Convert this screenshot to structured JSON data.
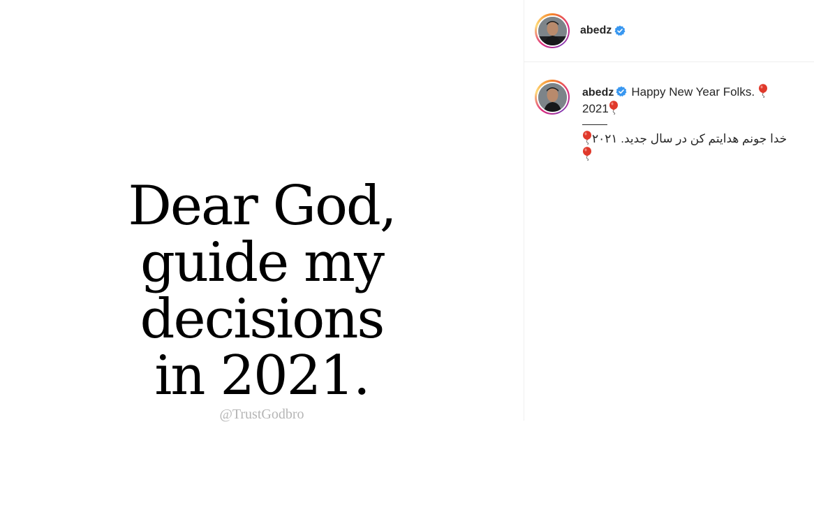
{
  "post": {
    "image": {
      "quote_lines": [
        "Dear God,",
        "guide my",
        "decisions",
        "in 2021."
      ],
      "watermark": "@TrustGodbro"
    },
    "header": {
      "username": "abedz",
      "verified_icon": "verified-badge-icon",
      "avatar_icon": "profile-photo"
    },
    "caption": {
      "username": "abedz",
      "line1": "Happy New Year Folks.",
      "line2": "2021",
      "persian": "خدا جونم هدایتم کن در سال جدید. ۲۰۲۱",
      "emoji_icon": "balloon-icon"
    },
    "colors": {
      "verified": "#3897f0",
      "balloon": "#e0392b",
      "ring_start": "#f58529",
      "ring_end": "#dd2a7b"
    }
  }
}
